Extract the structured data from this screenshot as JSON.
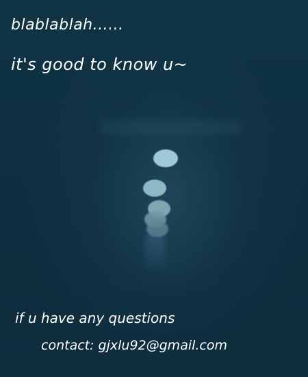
{
  "text": {
    "line1": "blablablah......",
    "line2": "it's good to know u~",
    "line3": "if u have any questions",
    "line4": "contact: gjxlu92@gmail.com"
  },
  "colors": {
    "background": "#0f3142",
    "text": "#ffffff",
    "light_dot": "#9ecad8"
  }
}
